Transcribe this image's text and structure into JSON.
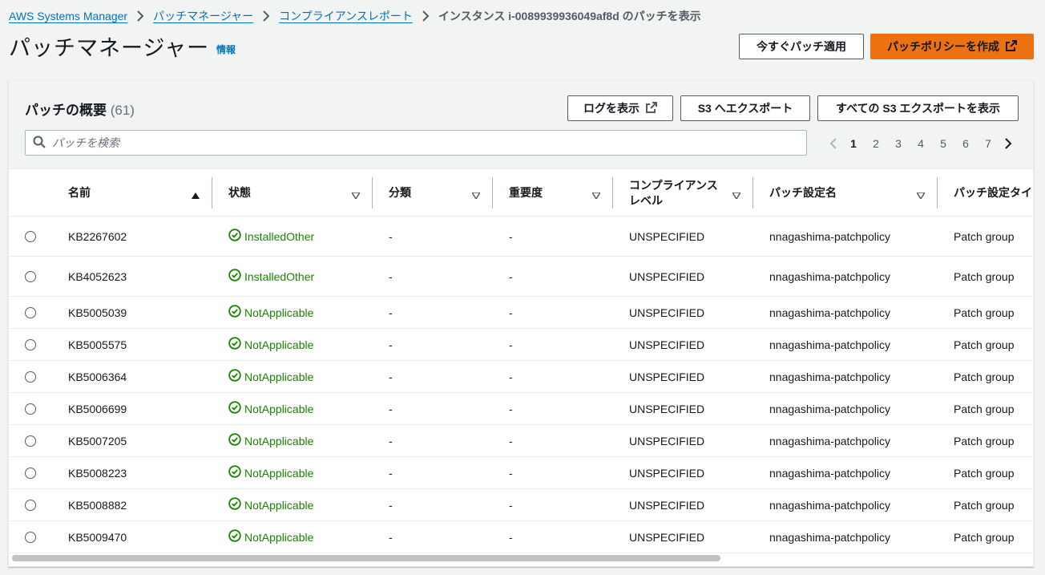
{
  "breadcrumb": {
    "items": [
      "AWS Systems Manager",
      "パッチマネージャー",
      "コンプライアンスレポート"
    ],
    "current": "インスタンス i-0089939936049af8d のパッチを表示"
  },
  "header": {
    "title": "パッチマネージャー",
    "info_label": "情報",
    "apply_patch_label": "今すぐパッチ適用",
    "create_policy_label": "パッチポリシーを作成"
  },
  "panel": {
    "title": "パッチの概要",
    "count": "(61)",
    "view_logs_label": "ログを表示",
    "export_s3_label": "S3 へエクスポート",
    "view_all_s3_label": "すべての S3 エクスポートを表示",
    "search_placeholder": "パッチを検索"
  },
  "pagination": {
    "pages": [
      "1",
      "2",
      "3",
      "4",
      "5",
      "6",
      "7"
    ],
    "current": "1"
  },
  "table": {
    "columns": {
      "name": "名前",
      "state": "状態",
      "classification": "分類",
      "severity": "重要度",
      "compliance_level_1": "コンプライアンス",
      "compliance_level_2": "レベル",
      "config_name": "パッチ設定名",
      "config_type": "パッチ設定タイプ"
    },
    "rows": [
      {
        "name": "KB2267602",
        "state": "InstalledOther",
        "classification": "-",
        "severity": "-",
        "compliance": "UNSPECIFIED",
        "config_name": "nnagashima-patchpolicy",
        "config_type": "Patch group"
      },
      {
        "name": "KB4052623",
        "state": "InstalledOther",
        "classification": "-",
        "severity": "-",
        "compliance": "UNSPECIFIED",
        "config_name": "nnagashima-patchpolicy",
        "config_type": "Patch group"
      },
      {
        "name": "KB5005039",
        "state": "NotApplicable",
        "classification": "-",
        "severity": "-",
        "compliance": "UNSPECIFIED",
        "config_name": "nnagashima-patchpolicy",
        "config_type": "Patch group"
      },
      {
        "name": "KB5005575",
        "state": "NotApplicable",
        "classification": "-",
        "severity": "-",
        "compliance": "UNSPECIFIED",
        "config_name": "nnagashima-patchpolicy",
        "config_type": "Patch group"
      },
      {
        "name": "KB5006364",
        "state": "NotApplicable",
        "classification": "-",
        "severity": "-",
        "compliance": "UNSPECIFIED",
        "config_name": "nnagashima-patchpolicy",
        "config_type": "Patch group"
      },
      {
        "name": "KB5006699",
        "state": "NotApplicable",
        "classification": "-",
        "severity": "-",
        "compliance": "UNSPECIFIED",
        "config_name": "nnagashima-patchpolicy",
        "config_type": "Patch group"
      },
      {
        "name": "KB5007205",
        "state": "NotApplicable",
        "classification": "-",
        "severity": "-",
        "compliance": "UNSPECIFIED",
        "config_name": "nnagashima-patchpolicy",
        "config_type": "Patch group"
      },
      {
        "name": "KB5008223",
        "state": "NotApplicable",
        "classification": "-",
        "severity": "-",
        "compliance": "UNSPECIFIED",
        "config_name": "nnagashima-patchpolicy",
        "config_type": "Patch group"
      },
      {
        "name": "KB5008882",
        "state": "NotApplicable",
        "classification": "-",
        "severity": "-",
        "compliance": "UNSPECIFIED",
        "config_name": "nnagashima-patchpolicy",
        "config_type": "Patch group"
      },
      {
        "name": "KB5009470",
        "state": "NotApplicable",
        "classification": "-",
        "severity": "-",
        "compliance": "UNSPECIFIED",
        "config_name": "nnagashima-patchpolicy",
        "config_type": "Patch group"
      }
    ]
  },
  "colors": {
    "link": "#0073bb",
    "primary_button": "#ec7211",
    "success": "#1d8102",
    "background": "#f2f3f3"
  },
  "icons": {
    "breadcrumb_separator": "chevron-right-icon",
    "external_link": "external-link-icon",
    "search": "search-icon",
    "sort_ascending": "sort-ascending-icon",
    "sort_descending": "sort-descending-icon",
    "status": "check-circle-icon",
    "page_prev": "chevron-left-icon",
    "page_next": "chevron-right-icon"
  }
}
